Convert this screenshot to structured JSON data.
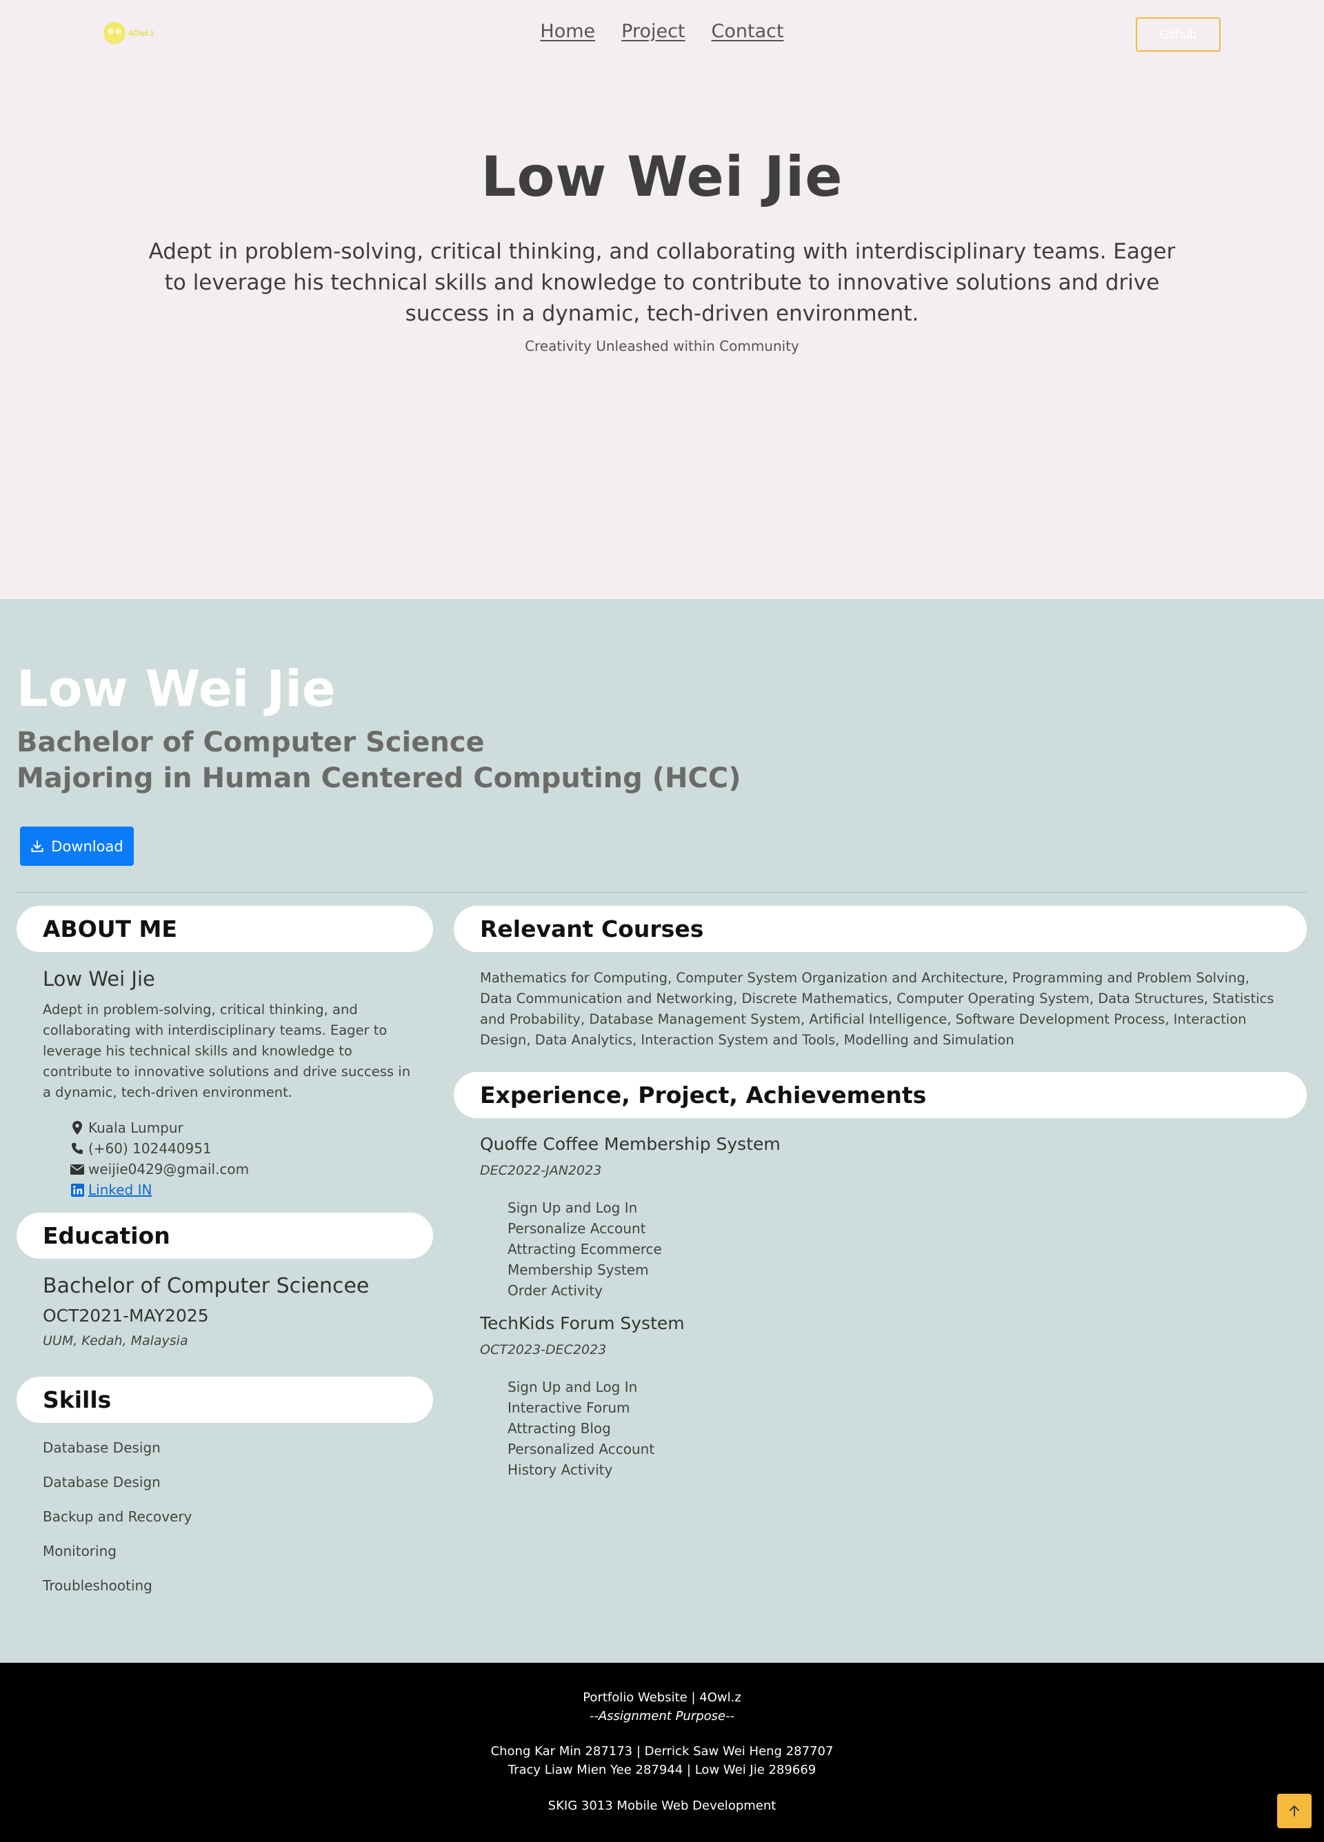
{
  "header": {
    "logo_text": "4Owl.z",
    "nav": [
      "Home",
      "Project",
      "Contact"
    ],
    "github_label": "Github"
  },
  "hero": {
    "title": "Low Wei Jie",
    "description": "Adept in problem-solving, critical thinking, and collaborating with interdisciplinary teams. Eager to leverage his technical skills and knowledge to contribute to innovative solutions and drive success in a dynamic, tech-driven environment.",
    "tagline": "Creativity Unleashed within Community"
  },
  "resume": {
    "name": "Low Wei Jie",
    "degree_line1": "Bachelor of Computer Science",
    "degree_line2": "Majoring in Human Centered Computing (HCC)",
    "download_label": "Download",
    "about": {
      "heading": "ABOUT ME",
      "name": "Low Wei Jie",
      "text": "Adept in problem-solving, critical thinking, and collaborating with interdisciplinary teams. Eager to leverage his technical skills and knowledge to contribute to innovative solutions and drive success in a dynamic, tech-driven environment.",
      "location": "Kuala Lumpur",
      "phone": "(+60) 102440951",
      "email": "weijie0429@gmail.com",
      "linkedin": "Linked IN"
    },
    "education": {
      "heading": "Education",
      "degree": "Bachelor of Computer Sciencee",
      "period": "OCT2021-MAY2025",
      "place": "UUM, Kedah, Malaysia"
    },
    "skills": {
      "heading": "Skills",
      "items": [
        "Database Design",
        "Database Design",
        "Backup and Recovery",
        "Monitoring",
        "Troubleshooting"
      ]
    },
    "courses": {
      "heading": "Relevant Courses",
      "text": "Mathematics for Computing, Computer System Organization and Architecture, Programming and Problem Solving, Data Communication and Networking, Discrete Mathematics, Computer Operating System, Data Structures, Statistics and Probability, Database Management System, Artificial Intelligence, Software Development Process, Interaction Design, Data Analytics, Interaction System and Tools, Modelling and Simulation"
    },
    "experience": {
      "heading": "Experience, Project, Achievements",
      "projects": [
        {
          "title": "Quoffe Coffee Membership System",
          "period": "DEC2022-JAN2023",
          "items": [
            "Sign Up and Log In",
            "Personalize Account",
            "Attracting Ecommerce",
            "Membership System",
            "Order Activity"
          ]
        },
        {
          "title": "TechKids Forum System",
          "period": "OCT2023-DEC2023",
          "items": [
            "Sign Up and Log In",
            "Interactive Forum",
            "Attracting Blog",
            "Personalized Account",
            "History Activity"
          ]
        }
      ]
    }
  },
  "footer": {
    "line1": "Portfolio Website | 4Owl.z",
    "line2": "--Assignment Purpose--",
    "line3": "Chong Kar Min 287173 | Derrick Saw Wei Heng 287707",
    "line4": "Tracy Liaw Mien Yee 287944 | Low Wei Jie 289669",
    "line5": "SKIG 3013 Mobile Web Development"
  },
  "colors": {
    "hero_bg": "#f4eef2",
    "resume_bg": "#cedddb",
    "accent_blue": "#0b7bf7",
    "accent_yellow": "#f5b93b",
    "footer_bg": "#000000"
  }
}
